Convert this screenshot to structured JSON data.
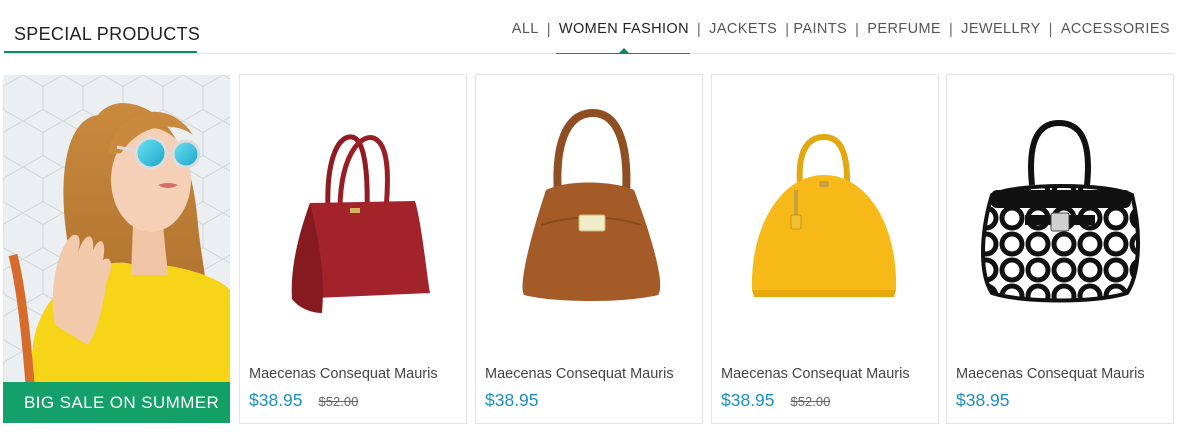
{
  "section": {
    "title": "SPECIAL PRODUCTS"
  },
  "tabs": [
    {
      "label": "ALL",
      "active": false
    },
    {
      "label": "WOMEN FASHION",
      "active": true
    },
    {
      "label": "JACKETS",
      "active": false
    },
    {
      "label": "PAINTS",
      "active": false
    },
    {
      "label": "PERFUME",
      "active": false
    },
    {
      "label": "JEWELLRY",
      "active": false
    },
    {
      "label": "ACCESSORIES",
      "active": false
    }
  ],
  "tab_separator": "|",
  "banner": {
    "label": "BIG SALE ON SUMMER"
  },
  "products": [
    {
      "name": "Maecenas Consequat Mauris",
      "price": "$38.95",
      "old_price": "$52.00",
      "bag": "red-tote-handbag"
    },
    {
      "name": "Maecenas Consequat Mauris",
      "price": "$38.95",
      "old_price": "",
      "bag": "brown-hobo-handbag"
    },
    {
      "name": "Maecenas Consequat Mauris",
      "price": "$38.95",
      "old_price": "$52.00",
      "bag": "yellow-dome-handbag"
    },
    {
      "name": "Maecenas Consequat Mauris",
      "price": "$38.95",
      "old_price": "",
      "bag": "black-white-pattern-handbag"
    }
  ],
  "colors": {
    "accent": "#0f8a5f",
    "price": "#1a8fbf",
    "banner_label_bg": "#15a06b"
  }
}
